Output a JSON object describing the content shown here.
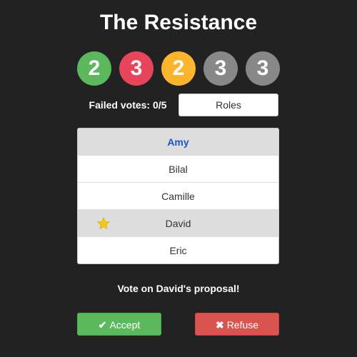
{
  "title": "The Resistance",
  "missions": [
    {
      "value": "2",
      "color": "#5cb85c"
    },
    {
      "value": "3",
      "color": "#e8455a"
    },
    {
      "value": "2",
      "color": "#fbb52c"
    },
    {
      "value": "3",
      "color": "#888888"
    },
    {
      "value": "3",
      "color": "#888888"
    }
  ],
  "failed_votes": {
    "label": "Failed votes:",
    "value": "0/5"
  },
  "roles_button": "Roles",
  "players": [
    {
      "name": "Amy",
      "highlight": true,
      "shaded": true,
      "leader": false
    },
    {
      "name": "Bilal",
      "highlight": false,
      "shaded": false,
      "leader": false
    },
    {
      "name": "Camille",
      "highlight": false,
      "shaded": false,
      "leader": false
    },
    {
      "name": "David",
      "highlight": false,
      "shaded": true,
      "leader": true
    },
    {
      "name": "Eric",
      "highlight": false,
      "shaded": false,
      "leader": false
    }
  ],
  "prompt": "Vote on David's proposal!",
  "accept": {
    "label": "Accept",
    "icon": "check-icon",
    "color": "#5cb85c"
  },
  "refuse": {
    "label": "Refuse",
    "icon": "x-icon",
    "color": "#d9534f"
  },
  "colors": {
    "background": "#222222",
    "highlight_text": "#1a56c8",
    "star": "#f5c518"
  }
}
